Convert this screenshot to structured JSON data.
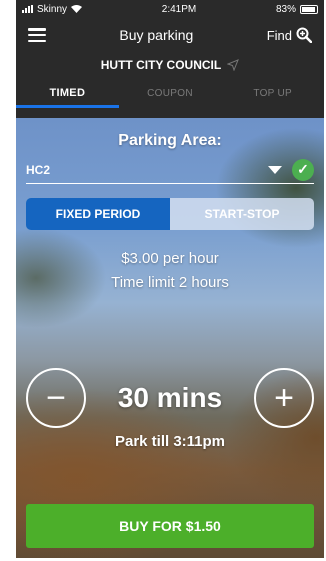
{
  "status_bar": {
    "carrier": "Skinny",
    "time": "2:41PM",
    "battery": "83%"
  },
  "nav": {
    "title": "Buy parking",
    "find_label": "Find"
  },
  "council": {
    "name": "HUTT CITY COUNCIL"
  },
  "tabs": [
    {
      "label": "TIMED",
      "active": true
    },
    {
      "label": "COUPON",
      "active": false
    },
    {
      "label": "TOP UP",
      "active": false
    }
  ],
  "parking_area": {
    "label": "Parking Area:",
    "selected": "HC2"
  },
  "mode_toggle": {
    "fixed_label": "FIXED PERIOD",
    "startstop_label": "START-STOP",
    "selected": "FIXED PERIOD"
  },
  "rate_text": "$3.00 per hour",
  "limit_text": "Time limit 2 hours",
  "duration": {
    "value": "30 mins",
    "minus_symbol": "−",
    "plus_symbol": "+"
  },
  "park_till": "Park till 3:11pm",
  "buy_button": {
    "label": "BUY FOR $1.50"
  },
  "colors": {
    "accent_blue": "#1565c0",
    "tab_indicator": "#1a73e8",
    "buy_green": "#4caf2a",
    "check_green": "#4caf50"
  }
}
